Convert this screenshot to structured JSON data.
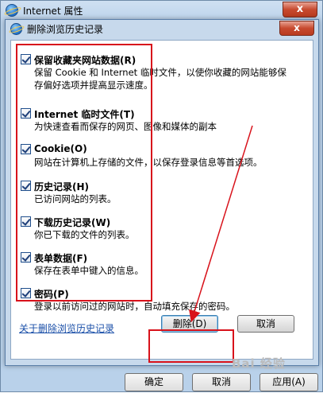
{
  "outer_window": {
    "title": "Internet 属性",
    "close_glyph": "x",
    "bottom_buttons": [
      "确定",
      "取消",
      "应用(A)"
    ]
  },
  "dialog": {
    "title": "删除浏览历史记录",
    "close_glyph": "x",
    "options": [
      {
        "title": "保留收藏夹网站数据(R)",
        "desc": "保留 Cookie 和 Internet 临时文件，以使你收藏的网站能够保存偏好选项并提高显示速度。",
        "checked": true
      },
      {
        "title": "Internet 临时文件(T)",
        "desc": "为快速查看而保存的网页、图像和媒体的副本",
        "checked": true
      },
      {
        "title": "Cookie(O)",
        "desc": "网站在计算机上存储的文件，以保存登录信息等首选项。",
        "checked": true
      },
      {
        "title": "历史记录(H)",
        "desc": "已访问网站的列表。",
        "checked": true
      },
      {
        "title": "下载历史记录(W)",
        "desc": "你已下载的文件的列表。",
        "checked": true
      },
      {
        "title": "表单数据(F)",
        "desc": "保存在表单中键入的信息。",
        "checked": true
      },
      {
        "title": "密码(P)",
        "desc": "登录以前访问过的网站时，自动填充保存的密码。",
        "checked": true
      }
    ],
    "help_link": "关于删除浏览历史记录",
    "delete_button": "删除(D)",
    "cancel_button": "取消"
  },
  "watermark": "Bai 经验",
  "colors": {
    "annotation_red": "#d8121b",
    "link_blue": "#1a4fa8",
    "dialog_frame": "#c7d9ec"
  }
}
